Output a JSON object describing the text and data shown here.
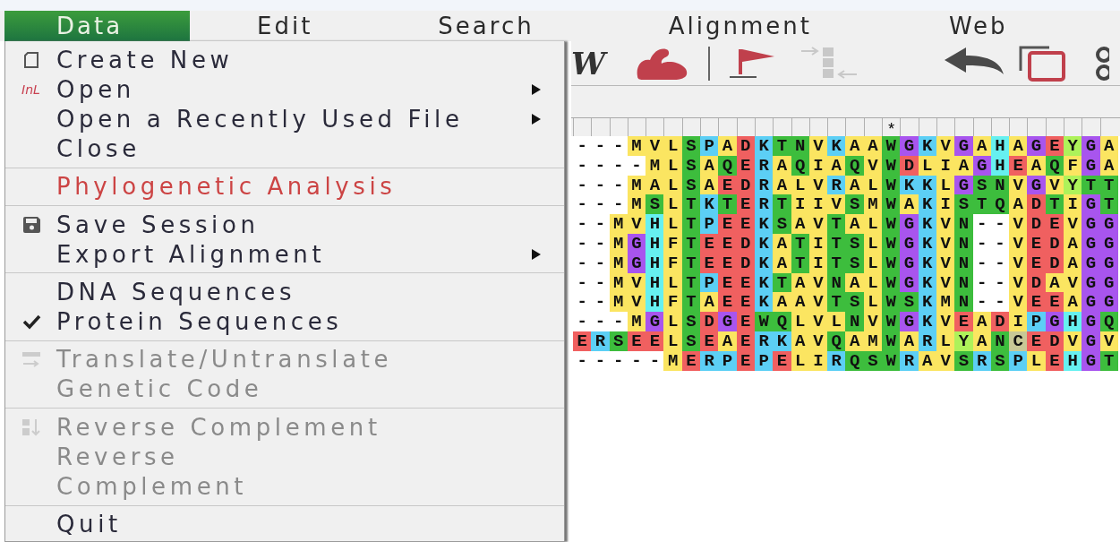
{
  "menubar": [
    {
      "label": "Data",
      "selected": true
    },
    {
      "label": "Edit",
      "selected": false
    },
    {
      "label": "Search",
      "selected": false
    },
    {
      "label": "Alignment",
      "selected": false
    },
    {
      "label": "Web",
      "selected": false
    }
  ],
  "toolbar": [
    {
      "kind": "glyph",
      "text": "W",
      "disabled": false
    },
    {
      "kind": "arm",
      "disabled": false
    },
    {
      "kind": "separator"
    },
    {
      "kind": "flag",
      "disabled": false
    },
    {
      "kind": "move",
      "disabled": true
    },
    {
      "kind": "undo",
      "disabled": false
    },
    {
      "kind": "copy",
      "disabled": false
    },
    {
      "kind": "rings",
      "disabled": false
    }
  ],
  "menu": [
    {
      "kind": "item",
      "label": "Create New",
      "disabled": false,
      "checked": false,
      "submenu": false,
      "emphasis": false
    },
    {
      "kind": "item",
      "label": "Open",
      "icon_text": "InL",
      "disabled": false,
      "checked": false,
      "submenu": true,
      "emphasis": false
    },
    {
      "kind": "item",
      "label": "Open a Recently Used File",
      "disabled": false,
      "checked": false,
      "submenu": true,
      "emphasis": false
    },
    {
      "kind": "item",
      "label": "Close",
      "disabled": false,
      "checked": false,
      "submenu": false,
      "emphasis": false
    },
    {
      "kind": "separator"
    },
    {
      "kind": "item",
      "label": "Phylogenetic Analysis",
      "disabled": false,
      "checked": false,
      "submenu": false,
      "emphasis": true
    },
    {
      "kind": "separator"
    },
    {
      "kind": "item",
      "label": "Save Session",
      "disabled": false,
      "checked": false,
      "submenu": false,
      "emphasis": false
    },
    {
      "kind": "item",
      "label": "Export Alignment",
      "disabled": false,
      "checked": false,
      "submenu": true,
      "emphasis": false
    },
    {
      "kind": "separator"
    },
    {
      "kind": "item",
      "label": "DNA Sequences",
      "disabled": false,
      "checked": false,
      "submenu": false,
      "emphasis": false
    },
    {
      "kind": "item",
      "label": "Protein Sequences",
      "disabled": false,
      "checked": true,
      "submenu": false,
      "emphasis": false
    },
    {
      "kind": "separator"
    },
    {
      "kind": "item",
      "label": "Translate/Untranslate",
      "disabled": true,
      "checked": false,
      "submenu": false,
      "emphasis": false
    },
    {
      "kind": "item",
      "label": "Genetic Code",
      "disabled": true,
      "checked": false,
      "submenu": false,
      "emphasis": false
    },
    {
      "kind": "separator"
    },
    {
      "kind": "item",
      "label": "Reverse Complement",
      "disabled": true,
      "checked": false,
      "submenu": false,
      "emphasis": false
    },
    {
      "kind": "item",
      "label": "Reverse",
      "disabled": true,
      "checked": false,
      "submenu": false,
      "emphasis": false
    },
    {
      "kind": "item",
      "label": "Complement",
      "disabled": true,
      "checked": false,
      "submenu": false,
      "emphasis": false
    },
    {
      "kind": "separator"
    },
    {
      "kind": "item",
      "label": "Quit",
      "disabled": false,
      "checked": false,
      "submenu": false,
      "emphasis": false
    }
  ],
  "ruler": {
    "marks": [
      {
        "text": "*"
      }
    ]
  },
  "sequences": [
    {
      "cells": [
        {
          "residue": "-"
        },
        {
          "residue": "-"
        },
        {
          "residue": "-"
        },
        {
          "residue": "M",
          "color": "#fbe561"
        },
        {
          "residue": "V",
          "color": "#fbe561"
        },
        {
          "residue": "L",
          "color": "#fbe561"
        },
        {
          "residue": "S",
          "color": "#3dbd3d"
        },
        {
          "residue": "P",
          "color": "#5ccff5"
        },
        {
          "residue": "A",
          "color": "#fbe561"
        },
        {
          "residue": "D",
          "color": "#f06060"
        },
        {
          "residue": "K",
          "color": "#5ccff5"
        },
        {
          "residue": "T",
          "color": "#3dbd3d"
        },
        {
          "residue": "N",
          "color": "#3dbd3d"
        },
        {
          "residue": "V",
          "color": "#fbe561"
        },
        {
          "residue": "K",
          "color": "#5ccff5"
        },
        {
          "residue": "A",
          "color": "#fbe561"
        },
        {
          "residue": "A",
          "color": "#fbe561"
        },
        {
          "residue": "W",
          "color": "#3dbd3d"
        },
        {
          "residue": "G",
          "color": "#a855ee"
        },
        {
          "residue": "K",
          "color": "#5ccff5"
        },
        {
          "residue": "V",
          "color": "#fbe561"
        },
        {
          "residue": "G",
          "color": "#a855ee"
        },
        {
          "residue": "A",
          "color": "#fbe561"
        },
        {
          "residue": "H",
          "color": "#66f0f0"
        },
        {
          "residue": "A",
          "color": "#fbe561"
        },
        {
          "residue": "G",
          "color": "#a855ee"
        },
        {
          "residue": "E",
          "color": "#f06060"
        },
        {
          "residue": "Y",
          "color": "#aef25a"
        },
        {
          "residue": "G",
          "color": "#a855ee"
        },
        {
          "residue": "A",
          "color": "#fbe561"
        }
      ]
    },
    {
      "cells": [
        {
          "residue": "-"
        },
        {
          "residue": "-"
        },
        {
          "residue": "-"
        },
        {
          "residue": "-"
        },
        {
          "residue": "M",
          "color": "#fbe561"
        },
        {
          "residue": "L",
          "color": "#fbe561"
        },
        {
          "residue": "S",
          "color": "#3dbd3d"
        },
        {
          "residue": "A",
          "color": "#fbe561"
        },
        {
          "residue": "Q",
          "color": "#3dbd3d"
        },
        {
          "residue": "E",
          "color": "#f06060"
        },
        {
          "residue": "R",
          "color": "#5ccff5"
        },
        {
          "residue": "A",
          "color": "#fbe561"
        },
        {
          "residue": "Q",
          "color": "#3dbd3d"
        },
        {
          "residue": "I",
          "color": "#fbe561"
        },
        {
          "residue": "A",
          "color": "#fbe561"
        },
        {
          "residue": "Q",
          "color": "#3dbd3d"
        },
        {
          "residue": "V",
          "color": "#fbe561"
        },
        {
          "residue": "W",
          "color": "#3dbd3d"
        },
        {
          "residue": "D",
          "color": "#f06060"
        },
        {
          "residue": "L",
          "color": "#fbe561"
        },
        {
          "residue": "I",
          "color": "#fbe561"
        },
        {
          "residue": "A",
          "color": "#fbe561"
        },
        {
          "residue": "G",
          "color": "#a855ee"
        },
        {
          "residue": "H",
          "color": "#66f0f0"
        },
        {
          "residue": "E",
          "color": "#f06060"
        },
        {
          "residue": "A",
          "color": "#fbe561"
        },
        {
          "residue": "Q",
          "color": "#3dbd3d"
        },
        {
          "residue": "F",
          "color": "#fbe561"
        },
        {
          "residue": "G",
          "color": "#a855ee"
        },
        {
          "residue": "A",
          "color": "#fbe561"
        }
      ]
    },
    {
      "cells": [
        {
          "residue": "-"
        },
        {
          "residue": "-"
        },
        {
          "residue": "-"
        },
        {
          "residue": "M",
          "color": "#fbe561"
        },
        {
          "residue": "A",
          "color": "#fbe561"
        },
        {
          "residue": "L",
          "color": "#fbe561"
        },
        {
          "residue": "S",
          "color": "#3dbd3d"
        },
        {
          "residue": "A",
          "color": "#fbe561"
        },
        {
          "residue": "E",
          "color": "#f06060"
        },
        {
          "residue": "D",
          "color": "#f06060"
        },
        {
          "residue": "R",
          "color": "#5ccff5"
        },
        {
          "residue": "A",
          "color": "#fbe561"
        },
        {
          "residue": "L",
          "color": "#fbe561"
        },
        {
          "residue": "V",
          "color": "#fbe561"
        },
        {
          "residue": "R",
          "color": "#5ccff5"
        },
        {
          "residue": "A",
          "color": "#fbe561"
        },
        {
          "residue": "L",
          "color": "#fbe561"
        },
        {
          "residue": "W",
          "color": "#3dbd3d"
        },
        {
          "residue": "K",
          "color": "#5ccff5"
        },
        {
          "residue": "K",
          "color": "#5ccff5"
        },
        {
          "residue": "L",
          "color": "#fbe561"
        },
        {
          "residue": "G",
          "color": "#a855ee"
        },
        {
          "residue": "S",
          "color": "#3dbd3d"
        },
        {
          "residue": "N",
          "color": "#3dbd3d"
        },
        {
          "residue": "V",
          "color": "#fbe561"
        },
        {
          "residue": "G",
          "color": "#a855ee"
        },
        {
          "residue": "V",
          "color": "#fbe561"
        },
        {
          "residue": "Y",
          "color": "#aef25a"
        },
        {
          "residue": "T",
          "color": "#3dbd3d"
        },
        {
          "residue": "T",
          "color": "#3dbd3d"
        }
      ]
    },
    {
      "cells": [
        {
          "residue": "-"
        },
        {
          "residue": "-"
        },
        {
          "residue": "-"
        },
        {
          "residue": "M",
          "color": "#fbe561"
        },
        {
          "residue": "S",
          "color": "#3dbd3d"
        },
        {
          "residue": "L",
          "color": "#fbe561"
        },
        {
          "residue": "T",
          "color": "#3dbd3d"
        },
        {
          "residue": "K",
          "color": "#5ccff5"
        },
        {
          "residue": "T",
          "color": "#3dbd3d"
        },
        {
          "residue": "E",
          "color": "#f06060"
        },
        {
          "residue": "R",
          "color": "#5ccff5"
        },
        {
          "residue": "T",
          "color": "#3dbd3d"
        },
        {
          "residue": "I",
          "color": "#fbe561"
        },
        {
          "residue": "I",
          "color": "#fbe561"
        },
        {
          "residue": "V",
          "color": "#fbe561"
        },
        {
          "residue": "S",
          "color": "#3dbd3d"
        },
        {
          "residue": "M",
          "color": "#fbe561"
        },
        {
          "residue": "W",
          "color": "#3dbd3d"
        },
        {
          "residue": "A",
          "color": "#fbe561"
        },
        {
          "residue": "K",
          "color": "#5ccff5"
        },
        {
          "residue": "I",
          "color": "#fbe561"
        },
        {
          "residue": "S",
          "color": "#3dbd3d"
        },
        {
          "residue": "T",
          "color": "#3dbd3d"
        },
        {
          "residue": "Q",
          "color": "#3dbd3d"
        },
        {
          "residue": "A",
          "color": "#fbe561"
        },
        {
          "residue": "D",
          "color": "#f06060"
        },
        {
          "residue": "T",
          "color": "#3dbd3d"
        },
        {
          "residue": "I",
          "color": "#fbe561"
        },
        {
          "residue": "G",
          "color": "#a855ee"
        },
        {
          "residue": "T",
          "color": "#3dbd3d"
        }
      ]
    },
    {
      "cells": [
        {
          "residue": "-"
        },
        {
          "residue": "-"
        },
        {
          "residue": "M",
          "color": "#fbe561"
        },
        {
          "residue": "V",
          "color": "#fbe561"
        },
        {
          "residue": "H",
          "color": "#66f0f0"
        },
        {
          "residue": "L",
          "color": "#fbe561"
        },
        {
          "residue": "T",
          "color": "#3dbd3d"
        },
        {
          "residue": "P",
          "color": "#5ccff5"
        },
        {
          "residue": "E",
          "color": "#f06060"
        },
        {
          "residue": "E",
          "color": "#f06060"
        },
        {
          "residue": "K",
          "color": "#5ccff5"
        },
        {
          "residue": "S",
          "color": "#3dbd3d"
        },
        {
          "residue": "A",
          "color": "#fbe561"
        },
        {
          "residue": "V",
          "color": "#fbe561"
        },
        {
          "residue": "T",
          "color": "#3dbd3d"
        },
        {
          "residue": "A",
          "color": "#fbe561"
        },
        {
          "residue": "L",
          "color": "#fbe561"
        },
        {
          "residue": "W",
          "color": "#3dbd3d"
        },
        {
          "residue": "G",
          "color": "#a855ee"
        },
        {
          "residue": "K",
          "color": "#5ccff5"
        },
        {
          "residue": "V",
          "color": "#fbe561"
        },
        {
          "residue": "N",
          "color": "#3dbd3d"
        },
        {
          "residue": "-"
        },
        {
          "residue": "-"
        },
        {
          "residue": "V",
          "color": "#fbe561"
        },
        {
          "residue": "D",
          "color": "#f06060"
        },
        {
          "residue": "E",
          "color": "#f06060"
        },
        {
          "residue": "V",
          "color": "#fbe561"
        },
        {
          "residue": "G",
          "color": "#a855ee"
        },
        {
          "residue": "G",
          "color": "#a855ee"
        }
      ]
    },
    {
      "cells": [
        {
          "residue": "-"
        },
        {
          "residue": "-"
        },
        {
          "residue": "M",
          "color": "#fbe561"
        },
        {
          "residue": "G",
          "color": "#a855ee"
        },
        {
          "residue": "H",
          "color": "#66f0f0"
        },
        {
          "residue": "F",
          "color": "#fbe561"
        },
        {
          "residue": "T",
          "color": "#3dbd3d"
        },
        {
          "residue": "E",
          "color": "#f06060"
        },
        {
          "residue": "E",
          "color": "#f06060"
        },
        {
          "residue": "D",
          "color": "#f06060"
        },
        {
          "residue": "K",
          "color": "#5ccff5"
        },
        {
          "residue": "A",
          "color": "#fbe561"
        },
        {
          "residue": "T",
          "color": "#3dbd3d"
        },
        {
          "residue": "I",
          "color": "#fbe561"
        },
        {
          "residue": "T",
          "color": "#3dbd3d"
        },
        {
          "residue": "S",
          "color": "#3dbd3d"
        },
        {
          "residue": "L",
          "color": "#fbe561"
        },
        {
          "residue": "W",
          "color": "#3dbd3d"
        },
        {
          "residue": "G",
          "color": "#a855ee"
        },
        {
          "residue": "K",
          "color": "#5ccff5"
        },
        {
          "residue": "V",
          "color": "#fbe561"
        },
        {
          "residue": "N",
          "color": "#3dbd3d"
        },
        {
          "residue": "-"
        },
        {
          "residue": "-"
        },
        {
          "residue": "V",
          "color": "#fbe561"
        },
        {
          "residue": "E",
          "color": "#f06060"
        },
        {
          "residue": "D",
          "color": "#f06060"
        },
        {
          "residue": "A",
          "color": "#fbe561"
        },
        {
          "residue": "G",
          "color": "#a855ee"
        },
        {
          "residue": "G",
          "color": "#a855ee"
        }
      ]
    },
    {
      "cells": [
        {
          "residue": "-"
        },
        {
          "residue": "-"
        },
        {
          "residue": "M",
          "color": "#fbe561"
        },
        {
          "residue": "G",
          "color": "#a855ee"
        },
        {
          "residue": "H",
          "color": "#66f0f0"
        },
        {
          "residue": "F",
          "color": "#fbe561"
        },
        {
          "residue": "T",
          "color": "#3dbd3d"
        },
        {
          "residue": "E",
          "color": "#f06060"
        },
        {
          "residue": "E",
          "color": "#f06060"
        },
        {
          "residue": "D",
          "color": "#f06060"
        },
        {
          "residue": "K",
          "color": "#5ccff5"
        },
        {
          "residue": "A",
          "color": "#fbe561"
        },
        {
          "residue": "T",
          "color": "#3dbd3d"
        },
        {
          "residue": "I",
          "color": "#fbe561"
        },
        {
          "residue": "T",
          "color": "#3dbd3d"
        },
        {
          "residue": "S",
          "color": "#3dbd3d"
        },
        {
          "residue": "L",
          "color": "#fbe561"
        },
        {
          "residue": "W",
          "color": "#3dbd3d"
        },
        {
          "residue": "G",
          "color": "#a855ee"
        },
        {
          "residue": "K",
          "color": "#5ccff5"
        },
        {
          "residue": "V",
          "color": "#fbe561"
        },
        {
          "residue": "N",
          "color": "#3dbd3d"
        },
        {
          "residue": "-"
        },
        {
          "residue": "-"
        },
        {
          "residue": "V",
          "color": "#fbe561"
        },
        {
          "residue": "E",
          "color": "#f06060"
        },
        {
          "residue": "D",
          "color": "#f06060"
        },
        {
          "residue": "A",
          "color": "#fbe561"
        },
        {
          "residue": "G",
          "color": "#a855ee"
        },
        {
          "residue": "G",
          "color": "#a855ee"
        }
      ]
    },
    {
      "cells": [
        {
          "residue": "-"
        },
        {
          "residue": "-"
        },
        {
          "residue": "M",
          "color": "#fbe561"
        },
        {
          "residue": "V",
          "color": "#fbe561"
        },
        {
          "residue": "H",
          "color": "#66f0f0"
        },
        {
          "residue": "L",
          "color": "#fbe561"
        },
        {
          "residue": "T",
          "color": "#3dbd3d"
        },
        {
          "residue": "P",
          "color": "#5ccff5"
        },
        {
          "residue": "E",
          "color": "#f06060"
        },
        {
          "residue": "E",
          "color": "#f06060"
        },
        {
          "residue": "K",
          "color": "#5ccff5"
        },
        {
          "residue": "T",
          "color": "#3dbd3d"
        },
        {
          "residue": "A",
          "color": "#fbe561"
        },
        {
          "residue": "V",
          "color": "#fbe561"
        },
        {
          "residue": "N",
          "color": "#3dbd3d"
        },
        {
          "residue": "A",
          "color": "#fbe561"
        },
        {
          "residue": "L",
          "color": "#fbe561"
        },
        {
          "residue": "W",
          "color": "#3dbd3d"
        },
        {
          "residue": "G",
          "color": "#a855ee"
        },
        {
          "residue": "K",
          "color": "#5ccff5"
        },
        {
          "residue": "V",
          "color": "#fbe561"
        },
        {
          "residue": "N",
          "color": "#3dbd3d"
        },
        {
          "residue": "-"
        },
        {
          "residue": "-"
        },
        {
          "residue": "V",
          "color": "#fbe561"
        },
        {
          "residue": "D",
          "color": "#f06060"
        },
        {
          "residue": "A",
          "color": "#fbe561"
        },
        {
          "residue": "V",
          "color": "#fbe561"
        },
        {
          "residue": "G",
          "color": "#a855ee"
        },
        {
          "residue": "G",
          "color": "#a855ee"
        }
      ]
    },
    {
      "cells": [
        {
          "residue": "-"
        },
        {
          "residue": "-"
        },
        {
          "residue": "M",
          "color": "#fbe561"
        },
        {
          "residue": "V",
          "color": "#fbe561"
        },
        {
          "residue": "H",
          "color": "#66f0f0"
        },
        {
          "residue": "F",
          "color": "#fbe561"
        },
        {
          "residue": "T",
          "color": "#3dbd3d"
        },
        {
          "residue": "A",
          "color": "#fbe561"
        },
        {
          "residue": "E",
          "color": "#f06060"
        },
        {
          "residue": "E",
          "color": "#f06060"
        },
        {
          "residue": "K",
          "color": "#5ccff5"
        },
        {
          "residue": "A",
          "color": "#fbe561"
        },
        {
          "residue": "A",
          "color": "#fbe561"
        },
        {
          "residue": "V",
          "color": "#fbe561"
        },
        {
          "residue": "T",
          "color": "#3dbd3d"
        },
        {
          "residue": "S",
          "color": "#3dbd3d"
        },
        {
          "residue": "L",
          "color": "#fbe561"
        },
        {
          "residue": "W",
          "color": "#3dbd3d"
        },
        {
          "residue": "S",
          "color": "#3dbd3d"
        },
        {
          "residue": "K",
          "color": "#5ccff5"
        },
        {
          "residue": "M",
          "color": "#fbe561"
        },
        {
          "residue": "N",
          "color": "#3dbd3d"
        },
        {
          "residue": "-"
        },
        {
          "residue": "-"
        },
        {
          "residue": "V",
          "color": "#fbe561"
        },
        {
          "residue": "E",
          "color": "#f06060"
        },
        {
          "residue": "E",
          "color": "#f06060"
        },
        {
          "residue": "A",
          "color": "#fbe561"
        },
        {
          "residue": "G",
          "color": "#a855ee"
        },
        {
          "residue": "G",
          "color": "#a855ee"
        }
      ]
    },
    {
      "cells": [
        {
          "residue": "-"
        },
        {
          "residue": "-"
        },
        {
          "residue": "-"
        },
        {
          "residue": "M",
          "color": "#fbe561"
        },
        {
          "residue": "G",
          "color": "#a855ee"
        },
        {
          "residue": "L",
          "color": "#fbe561"
        },
        {
          "residue": "S",
          "color": "#3dbd3d"
        },
        {
          "residue": "D",
          "color": "#f06060"
        },
        {
          "residue": "G",
          "color": "#a855ee"
        },
        {
          "residue": "E",
          "color": "#f06060"
        },
        {
          "residue": "W",
          "color": "#3dbd3d"
        },
        {
          "residue": "Q",
          "color": "#3dbd3d"
        },
        {
          "residue": "L",
          "color": "#fbe561"
        },
        {
          "residue": "V",
          "color": "#fbe561"
        },
        {
          "residue": "L",
          "color": "#fbe561"
        },
        {
          "residue": "N",
          "color": "#3dbd3d"
        },
        {
          "residue": "V",
          "color": "#fbe561"
        },
        {
          "residue": "W",
          "color": "#3dbd3d"
        },
        {
          "residue": "G",
          "color": "#a855ee"
        },
        {
          "residue": "K",
          "color": "#5ccff5"
        },
        {
          "residue": "V",
          "color": "#fbe561"
        },
        {
          "residue": "E",
          "color": "#f06060"
        },
        {
          "residue": "A",
          "color": "#fbe561"
        },
        {
          "residue": "D",
          "color": "#f06060"
        },
        {
          "residue": "I",
          "color": "#fbe561"
        },
        {
          "residue": "P",
          "color": "#5ccff5"
        },
        {
          "residue": "G",
          "color": "#a855ee"
        },
        {
          "residue": "H",
          "color": "#66f0f0"
        },
        {
          "residue": "G",
          "color": "#a855ee"
        },
        {
          "residue": "Q",
          "color": "#3dbd3d"
        }
      ]
    },
    {
      "cells": [
        {
          "residue": "E",
          "color": "#f06060"
        },
        {
          "residue": "R",
          "color": "#5ccff5"
        },
        {
          "residue": "S",
          "color": "#3dbd3d"
        },
        {
          "residue": "E",
          "color": "#f06060"
        },
        {
          "residue": "E",
          "color": "#f06060"
        },
        {
          "residue": "L",
          "color": "#fbe561"
        },
        {
          "residue": "S",
          "color": "#3dbd3d"
        },
        {
          "residue": "E",
          "color": "#f06060"
        },
        {
          "residue": "A",
          "color": "#fbe561"
        },
        {
          "residue": "E",
          "color": "#f06060"
        },
        {
          "residue": "R",
          "color": "#5ccff5"
        },
        {
          "residue": "K",
          "color": "#5ccff5"
        },
        {
          "residue": "A",
          "color": "#fbe561"
        },
        {
          "residue": "V",
          "color": "#fbe561"
        },
        {
          "residue": "Q",
          "color": "#3dbd3d"
        },
        {
          "residue": "A",
          "color": "#fbe561"
        },
        {
          "residue": "M",
          "color": "#fbe561"
        },
        {
          "residue": "W",
          "color": "#3dbd3d"
        },
        {
          "residue": "A",
          "color": "#fbe561"
        },
        {
          "residue": "R",
          "color": "#5ccff5"
        },
        {
          "residue": "L",
          "color": "#fbe561"
        },
        {
          "residue": "Y",
          "color": "#aef25a"
        },
        {
          "residue": "A",
          "color": "#fbe561"
        },
        {
          "residue": "N",
          "color": "#3dbd3d"
        },
        {
          "residue": "C",
          "color": "#c8c896"
        },
        {
          "residue": "E",
          "color": "#f06060"
        },
        {
          "residue": "D",
          "color": "#f06060"
        },
        {
          "residue": "V",
          "color": "#fbe561"
        },
        {
          "residue": "G",
          "color": "#a855ee"
        },
        {
          "residue": "V",
          "color": "#fbe561"
        }
      ]
    },
    {
      "cells": [
        {
          "residue": "-"
        },
        {
          "residue": "-"
        },
        {
          "residue": "-"
        },
        {
          "residue": "-"
        },
        {
          "residue": "-"
        },
        {
          "residue": "M",
          "color": "#fbe561"
        },
        {
          "residue": "E",
          "color": "#f06060"
        },
        {
          "residue": "R",
          "color": "#5ccff5"
        },
        {
          "residue": "P",
          "color": "#5ccff5"
        },
        {
          "residue": "E",
          "color": "#f06060"
        },
        {
          "residue": "P",
          "color": "#5ccff5"
        },
        {
          "residue": "E",
          "color": "#f06060"
        },
        {
          "residue": "L",
          "color": "#fbe561"
        },
        {
          "residue": "I",
          "color": "#fbe561"
        },
        {
          "residue": "R",
          "color": "#5ccff5"
        },
        {
          "residue": "Q",
          "color": "#3dbd3d"
        },
        {
          "residue": "S",
          "color": "#3dbd3d"
        },
        {
          "residue": "W",
          "color": "#3dbd3d"
        },
        {
          "residue": "R",
          "color": "#5ccff5"
        },
        {
          "residue": "A",
          "color": "#fbe561"
        },
        {
          "residue": "V",
          "color": "#fbe561"
        },
        {
          "residue": "S",
          "color": "#3dbd3d"
        },
        {
          "residue": "R",
          "color": "#5ccff5"
        },
        {
          "residue": "S",
          "color": "#3dbd3d"
        },
        {
          "residue": "P",
          "color": "#5ccff5"
        },
        {
          "residue": "L",
          "color": "#fbe561"
        },
        {
          "residue": "E",
          "color": "#f06060"
        },
        {
          "residue": "H",
          "color": "#66f0f0"
        },
        {
          "residue": "G",
          "color": "#a855ee"
        },
        {
          "residue": "T",
          "color": "#3dbd3d"
        }
      ]
    }
  ]
}
